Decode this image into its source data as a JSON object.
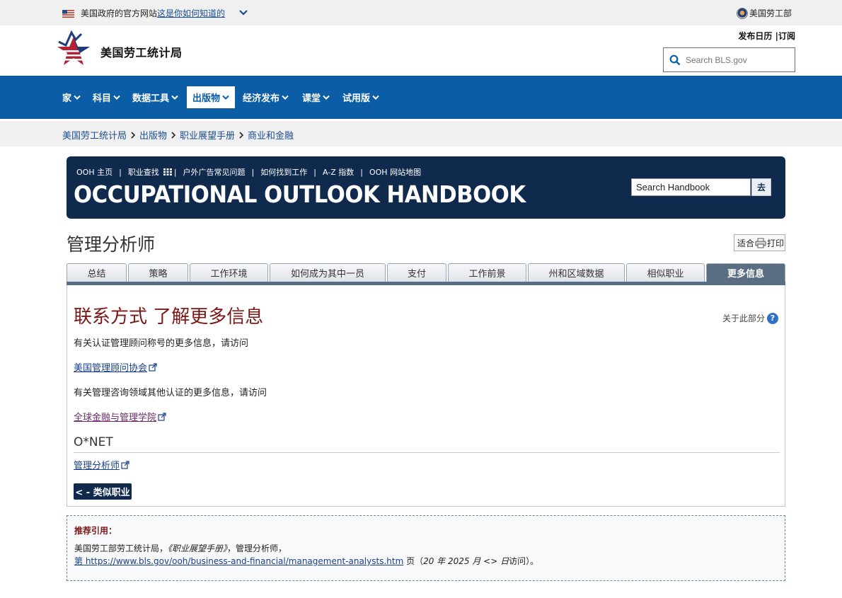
{
  "gov_banner": {
    "text": "美国政府的官方网站",
    "link": "这是你如何知道的",
    "agency": "美国劳工部"
  },
  "header": {
    "logo_text": "美国劳工统计局",
    "util_release": "发布日历",
    "util_sep": " |",
    "util_subscribe": "订阅",
    "search_placeholder": "Search BLS.gov"
  },
  "nav": {
    "items": [
      {
        "label": "家"
      },
      {
        "label": "科目"
      },
      {
        "label": "数据工具"
      },
      {
        "label": "出版物"
      },
      {
        "label": "经济发布"
      },
      {
        "label": "课堂"
      },
      {
        "label": "试用版"
      }
    ],
    "active_index": 3
  },
  "breadcrumb": [
    "美国劳工统计局",
    "出版物",
    "职业展望手册",
    "商业和金融"
  ],
  "ooh": {
    "links": [
      "OOH 主页",
      "职业查找",
      "户外广告常见问题",
      "如何找到工作",
      "A-Z 指数",
      "OOH 网站地图"
    ],
    "title": "OCCUPATIONAL OUTLOOK HANDBOOK",
    "search_value": "Search Handbook",
    "go": "去"
  },
  "page": {
    "title": "管理分析师",
    "print_a": "适合",
    "print_b": "打印"
  },
  "tabs": [
    "总结",
    "策略",
    "工作环境",
    "如何成为其中一员",
    "支付",
    "工作前景",
    "州和区域数据",
    "相似职业",
    "更多信息"
  ],
  "content": {
    "heading": "联系方式 了解更多信息",
    "about": "关于此部分",
    "about_icon": "?",
    "p1": "有关认证管理顾问称号的更多信息，请访问",
    "link1": "美国管理顾问协会",
    "p2": "有关管理咨询领域其他认证的更多信息，请访问",
    "link2": "全球金融与管理学院",
    "onet": "O*NET",
    "link3": "管理分析师",
    "back": "< - 类似职业"
  },
  "citation": {
    "heading": "推荐引用：",
    "line1_a": "美国劳工部劳工统计局，",
    "line1_b": "《职业展望手册》",
    "line1_c": "，管理分析师，",
    "line2_prefix": "第",
    "url": " https://www.bls.gov/ooh/business-and-financial/management-analysts.htm",
    "line2_mid": " 页（",
    "line2_date": "20 年 2025 月 <> 日",
    "line2_end": "访问）。"
  },
  "colors": {
    "nav_blue": "#0b5ea6",
    "ooh_navy": "#0f2a4d",
    "heading_red": "#7a1818",
    "tab_active": "#5a6d82"
  }
}
